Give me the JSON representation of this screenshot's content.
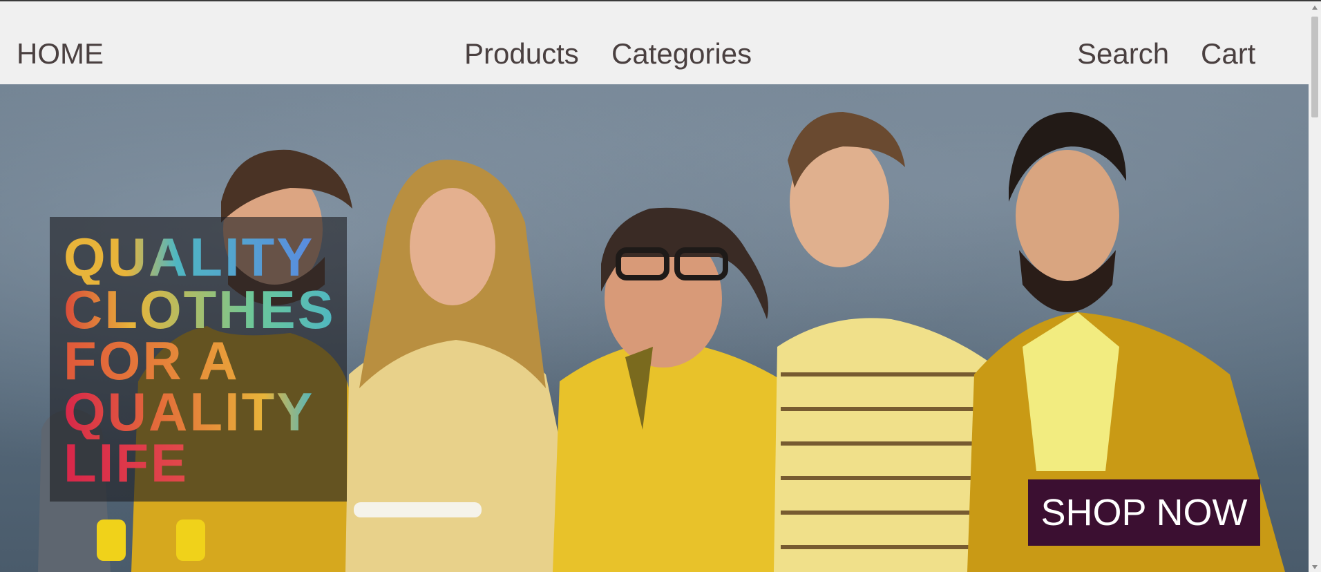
{
  "nav": {
    "home": "HOME",
    "products": "Products",
    "categories": "Categories",
    "search": "Search",
    "cart": "Cart"
  },
  "hero": {
    "headline_lines": [
      "QUALITY",
      "CLOTHES",
      "FOR A",
      "QUALITY",
      "LIFE"
    ],
    "cta_label": "SHOP NOW"
  },
  "colors": {
    "nav_text": "#4a4040",
    "nav_underline_start": "#7be6a8",
    "nav_underline_end": "#8cd6e6",
    "cta_background": "#3b0f31",
    "hero_text_box": "rgba(30,30,35,0.62)"
  }
}
